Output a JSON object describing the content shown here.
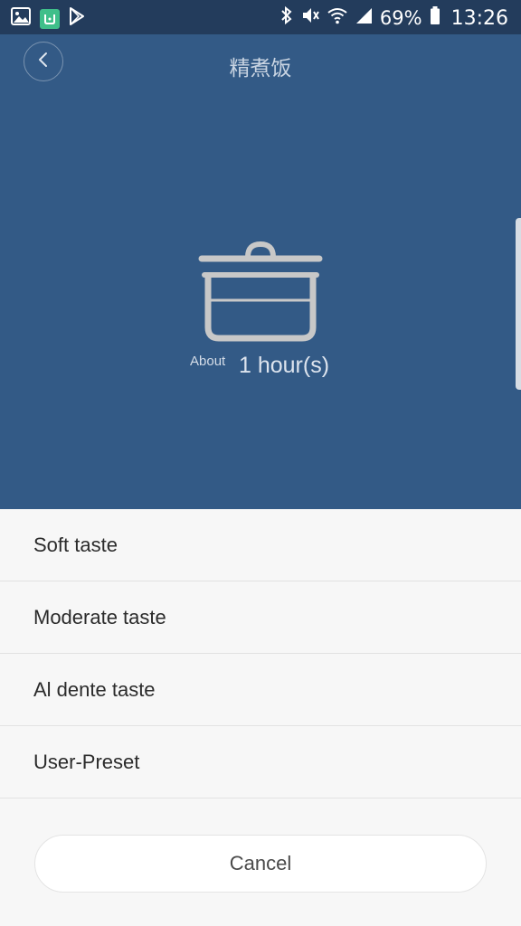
{
  "status_bar": {
    "icons_left": [
      "gallery-icon",
      "mi-home-app-icon",
      "play-store-icon"
    ],
    "icons_right": [
      "bluetooth-icon",
      "mute-icon",
      "wifi-icon",
      "signal-icon",
      "battery-icon"
    ],
    "battery": "69%",
    "time": "13:26"
  },
  "header": {
    "back_icon": "chevron-left-icon",
    "title": "精煮饭"
  },
  "hero": {
    "icon": "cooking-pot-icon",
    "duration_prefix": "About",
    "duration_value": "1 hour(s)",
    "background": "#335a86"
  },
  "options": [
    {
      "label": "Soft taste"
    },
    {
      "label": "Moderate taste"
    },
    {
      "label": "Al dente taste"
    },
    {
      "label": "User-Preset"
    }
  ],
  "cancel_label": "Cancel",
  "colors": {
    "status_bar": "#233c5c",
    "hero": "#335a86",
    "sheet": "#f7f7f7",
    "divider": "#e2e2e2"
  }
}
